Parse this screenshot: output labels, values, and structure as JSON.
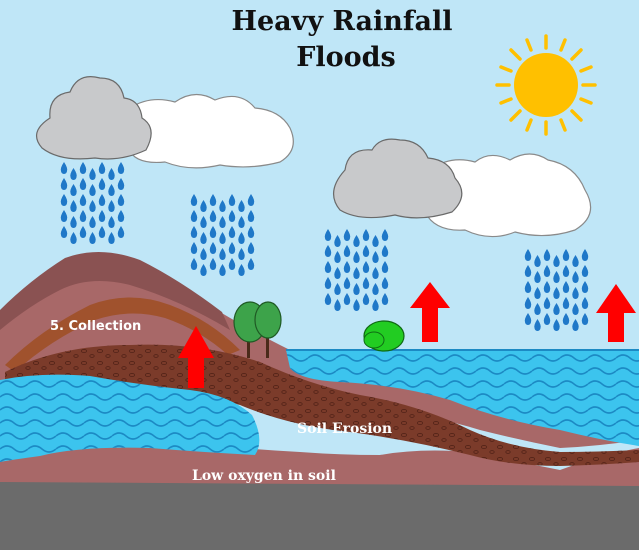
{
  "title": {
    "line1": "Heavy Rainfall",
    "line2": "Floods"
  },
  "labels": {
    "collection": "5. Collection",
    "soil_erosion": "Soil Erosion",
    "low_oxygen": "Low oxygen in soil"
  },
  "icons": {
    "sun": "sun-icon",
    "cloud": "cloud-icon",
    "rain": "raindrop-icon",
    "tree": "tree-icon",
    "bush": "bush-icon",
    "arrow": "up-arrow-icon"
  },
  "colors": {
    "sky": "#bfe6f7",
    "sun": "#ffc000",
    "cloud_dark": "#c8c9cb",
    "cloud_light": "#ffffff",
    "rain": "#1f78c8",
    "water": "#3cc4ee",
    "wave": "#1c8ac4",
    "mountain": "#955c5c",
    "soil_band": "#a0522d",
    "soil_eroded": "#7b3b2a",
    "bedrock": "#6b6b6b",
    "arrow": "#ff0000",
    "tree": "#3da34a"
  }
}
